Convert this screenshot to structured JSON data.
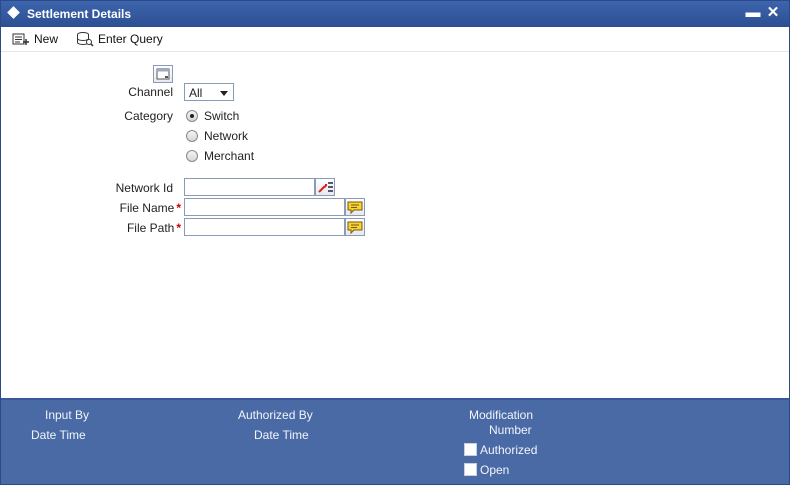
{
  "window": {
    "title": "Settlement Details",
    "minimize_glyph": "▬",
    "close_glyph": "✕"
  },
  "toolbar": {
    "new_label": "New",
    "enter_query_label": "Enter Query"
  },
  "form": {
    "channel_label": "Channel",
    "channel_value": "All",
    "category_label": "Category",
    "category_options": [
      "Switch",
      "Network",
      "Merchant"
    ],
    "category_selected": "Switch",
    "network_id_label": "Network Id",
    "network_id_value": "",
    "file_name_label": "File Name",
    "file_name_value": "",
    "file_path_label": "File Path",
    "file_path_value": "",
    "required_mark": "*"
  },
  "footer": {
    "input_by_label": "Input By",
    "date_time_label_1": "Date Time",
    "authorized_by_label": "Authorized By",
    "date_time_label_2": "Date Time",
    "modification_label": "Modification",
    "number_label": "Number",
    "authorized_checkbox_label": "Authorized",
    "open_checkbox_label": "Open"
  },
  "colors": {
    "title_bar": "#2c4f93",
    "footer": "#4a6aa6",
    "required": "#cc0000"
  }
}
